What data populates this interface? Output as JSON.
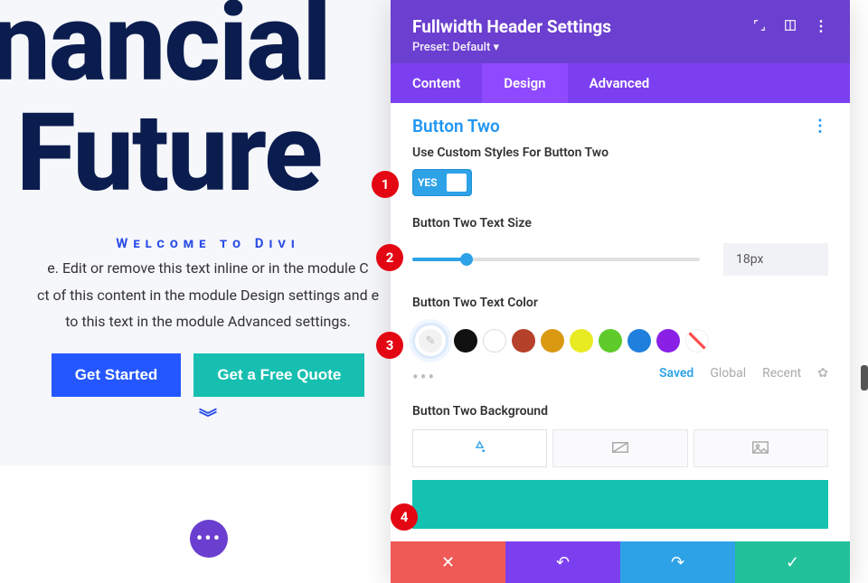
{
  "preview": {
    "hero_line1": "inancial",
    "hero_line2": "Future",
    "welcome": "Welcome to Divi",
    "body1": "e. Edit or remove this text inline or in the module C",
    "body2": "ct of this content in the module Design settings and e",
    "body3": "to this text in the module Advanced settings.",
    "btn_primary": "Get Started",
    "btn_secondary": "Get a Free Quote",
    "fab_dots": "•••"
  },
  "panel": {
    "title": "Fullwidth Header Settings",
    "preset_label": "Preset: Default",
    "tabs": {
      "content": "Content",
      "design": "Design",
      "advanced": "Advanced",
      "active": "design"
    },
    "section_title": "Button Two",
    "custom_styles_label": "Use Custom Styles For Button Two",
    "toggle_value": "YES",
    "text_size_label": "Button Two Text Size",
    "text_size_value": "18px",
    "text_color_label": "Button Two Text Color",
    "swatches": {
      "black": "#111111",
      "white": "#ffffff",
      "brick": "#b5412a",
      "amber": "#d99a12",
      "yellow": "#e8ea22",
      "green": "#5ecb2a",
      "blue": "#1f7fdc",
      "purple": "#8a20e6"
    },
    "filters": {
      "saved": "Saved",
      "global": "Global",
      "recent": "Recent"
    },
    "background_label": "Button Two Background",
    "background_color": "#14c2b2"
  },
  "callouts": {
    "one": "1",
    "two": "2",
    "three": "3",
    "four": "4"
  }
}
